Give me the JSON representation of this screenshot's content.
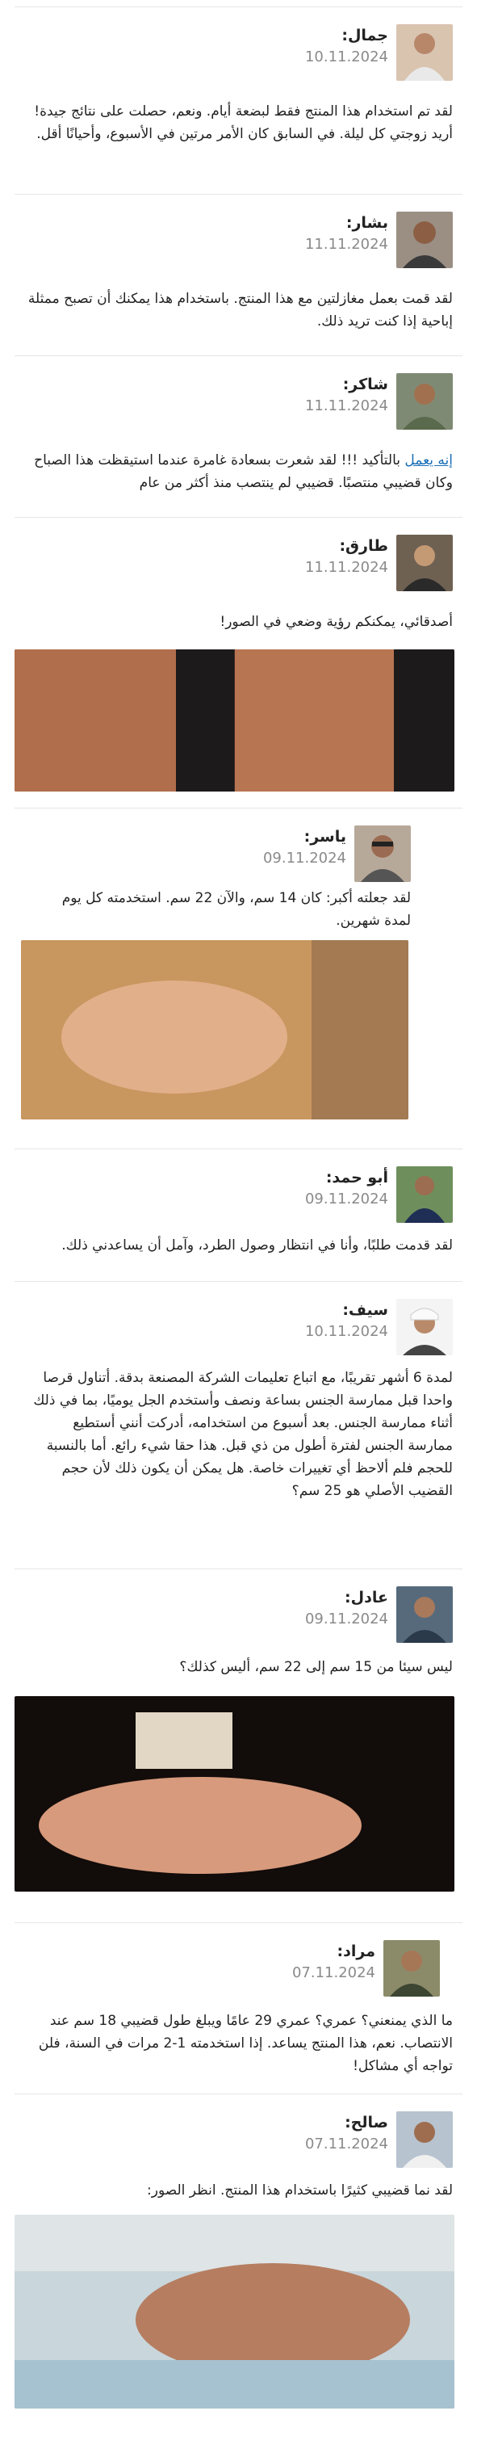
{
  "comments": [
    {
      "name": "جمال:",
      "date": "10.11.2024",
      "text": "لقد تم استخدام هذا المنتج فقط لبضعة أيام. ونعم، حصلت على نتائج جيدة! أريد زوجتي كل ليلة. في السابق كان الأمر مرتين في الأسبوع، وأحيانًا أقل."
    },
    {
      "name": "بشار:",
      "date": "11.11.2024",
      "text": "لقد قمت بعمل مغازلتين مع هذا المنتج. باستخدام هذا يمكنك أن تصبح ممثلة إباحية إذا كنت تريد ذلك."
    },
    {
      "name": "شاكر:",
      "date": "11.11.2024",
      "link": "إنه يعمل",
      "text": " بالتأكيد !!! لقد شعرت بسعادة غامرة عندما استيقظت هذا الصباح وكان قضيبي منتصبًا. قضيبي لم ينتصب منذ أكثر من عام"
    },
    {
      "name": "طارق:",
      "date": "11.11.2024",
      "text": "أصدقائي، يمكنكم رؤية وضعي في الصور!"
    },
    {
      "name": "ياسر:",
      "date": "09.11.2024",
      "text": "لقد جعلته أكبر: كان 14 سم، والآن 22 سم. استخدمته كل يوم لمدة شهرين."
    },
    {
      "name": "أبو حمد:",
      "date": "09.11.2024",
      "text": "لقد قدمت طلبًا، وأنا في انتظار وصول الطرد، وآمل أن يساعدني ذلك."
    },
    {
      "name": "سيف:",
      "date": "10.11.2024",
      "text": "لمدة 6 أشهر تقريبًا، مع اتباع تعليمات الشركة المصنعة بدقة. أتناول قرصا واحدا قبل ممارسة الجنس بساعة ونصف وأستخدم الجل يوميًا، بما في ذلك أثناء ممارسة الجنس. بعد أسبوع من استخدامه، أدركت أنني أستطيع ممارسة الجنس لفترة أطول من ذي قبل. هذا حقا شيء رائع. أما بالنسبة للحجم فلم ألاحظ أي تغييرات خاصة. هل يمكن أن يكون ذلك لأن حجم القضيب الأصلي هو 25 سم؟"
    },
    {
      "name": "عادل:",
      "date": "09.11.2024",
      "text": "ليس سيئا من 15 سم إلى 22 سم، أليس كذلك؟"
    },
    {
      "name": "مراد:",
      "date": "07.11.2024",
      "text": "ما الذي يمنعني؟ عمري؟ عمري 29 عامًا ويبلغ طول قضيبي 18 سم عند الانتصاب. نعم، هذا المنتج يساعد. إذا استخدمته 1-2 مرات في السنة، فلن تواجه أي مشاكل!"
    },
    {
      "name": "صالح:",
      "date": "07.11.2024",
      "text": "لقد نما قضيبي كثيرًا باستخدام هذا المنتج. انظر الصور:"
    }
  ]
}
